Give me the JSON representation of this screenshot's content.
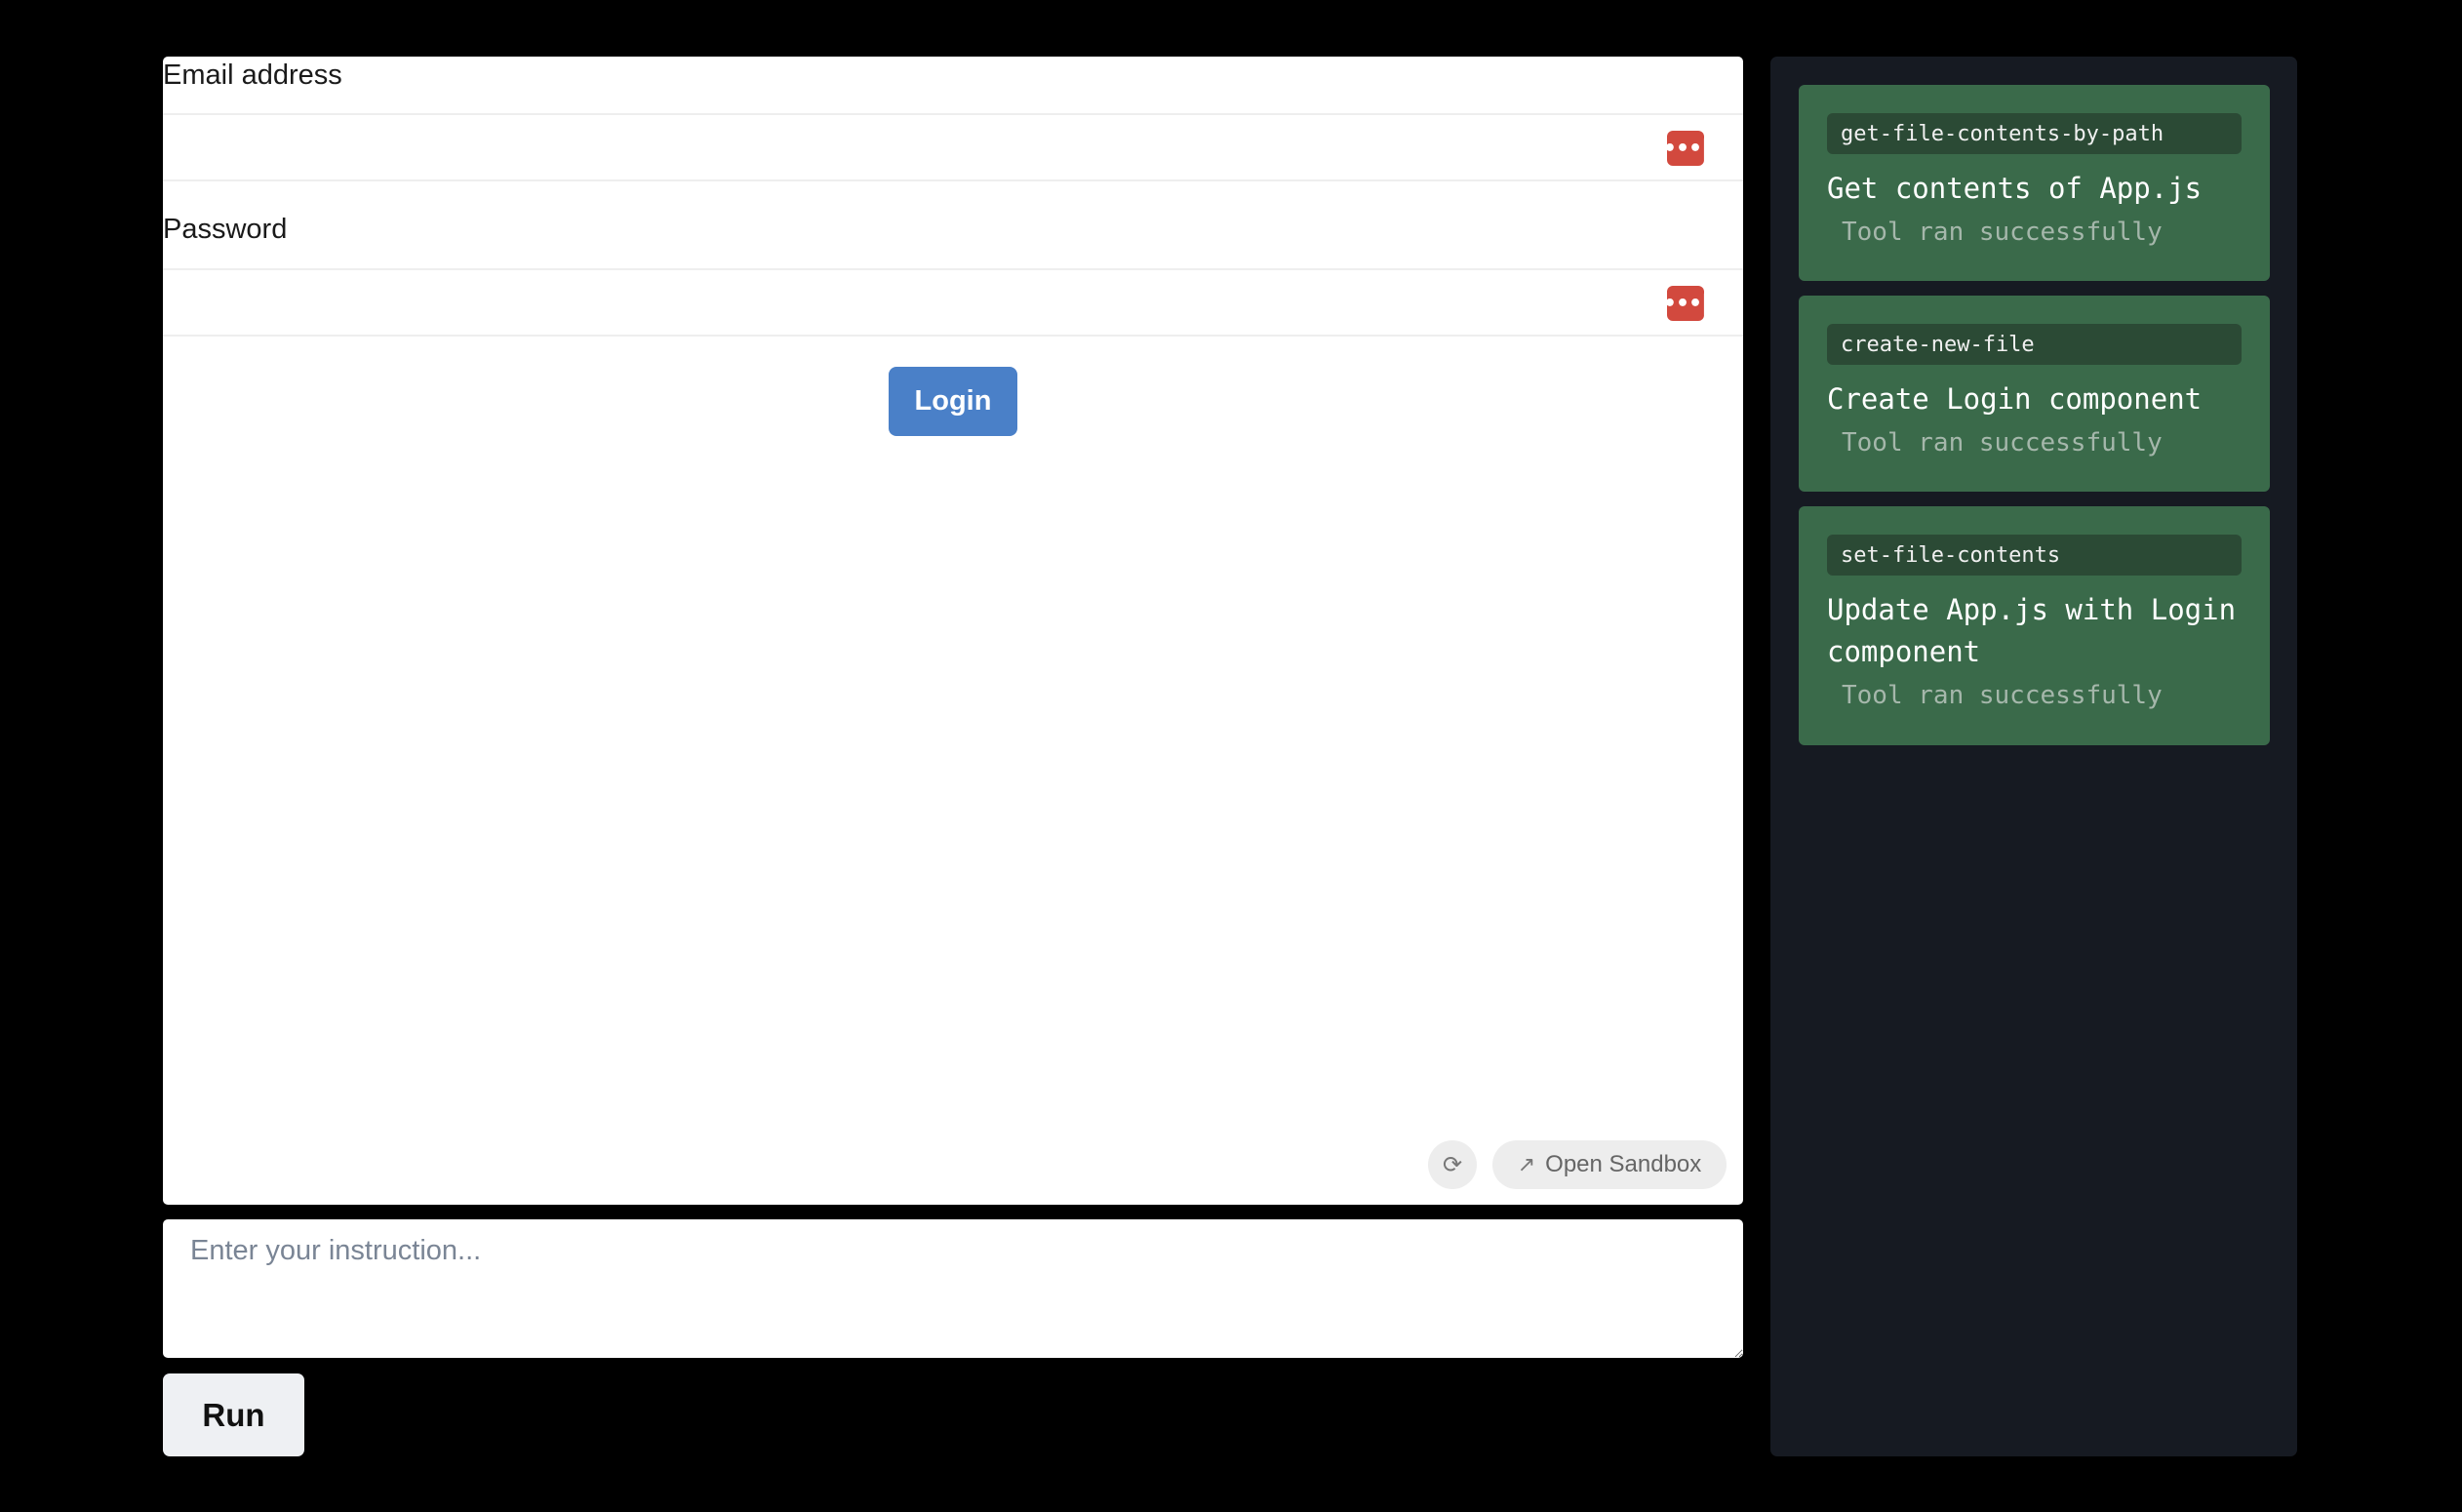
{
  "preview": {
    "email_label": "Email address",
    "password_label": "Password",
    "password_manager_icon": "•••|",
    "login_button": "Login",
    "refresh_icon": "⟳",
    "open_sandbox_icon": "↗",
    "open_sandbox_label": "Open Sandbox"
  },
  "instruction": {
    "placeholder": "Enter your instruction...",
    "value": ""
  },
  "run_button": "Run",
  "tools": [
    {
      "name": "get-file-contents-by-path",
      "title": "Get contents of App.js",
      "status": "Tool ran successfully"
    },
    {
      "name": "create-new-file",
      "title": "Create Login component",
      "status": "Tool ran successfully"
    },
    {
      "name": "set-file-contents",
      "title": "Update App.js with Login component",
      "status": "Tool ran successfully"
    }
  ],
  "colors": {
    "background": "#000000",
    "sidebar": "#161a22",
    "tool_card": "#3a6a4a",
    "login_button": "#4a80c8",
    "password_manager": "#d2493e"
  }
}
